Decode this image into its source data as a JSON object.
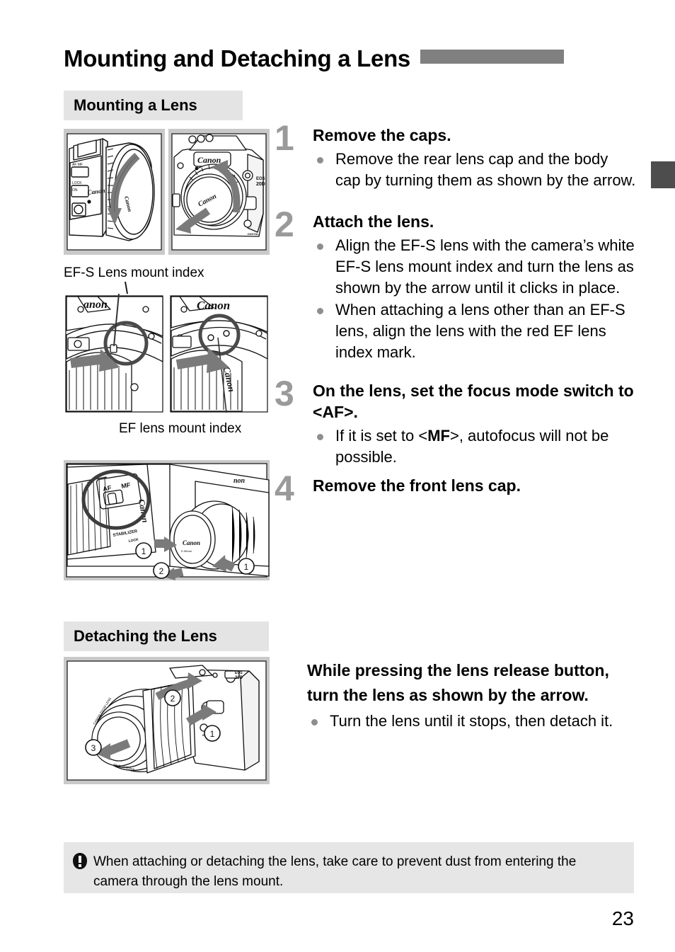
{
  "header": {
    "title": "Mounting and Detaching a Lens",
    "bar_color": "#808080",
    "edge_tab_color": "#4d4d4d"
  },
  "sections": {
    "mounting_label": "Mounting a Lens",
    "detaching_label": "Detaching the Lens",
    "chip_bg": "#e4e4e4"
  },
  "captions": {
    "efs_index": "EF-S Lens mount index",
    "ef_index": "EF lens mount index"
  },
  "figures": {
    "lens_cap": {
      "name": "lens-with-rear-cap",
      "labels": [
        "Canon",
        "AF",
        "MF",
        "LOCK",
        "ON"
      ]
    },
    "body_cap": {
      "name": "camera-body-with-body-cap",
      "labels": [
        "Canon",
        "EOS",
        "20D",
        "DIGITAL"
      ]
    },
    "efs_index": {
      "name": "efs-lens-mount-index-closeup",
      "labels": [
        "Canon"
      ]
    },
    "ef_index": {
      "name": "ef-lens-mount-index-closeup",
      "labels": [
        "Canon"
      ]
    },
    "focus_switch": {
      "name": "focus-mode-switch-and-front-cap",
      "labels": [
        "AF",
        "MF",
        "STABILIZER",
        "Canon",
        "Canon"
      ],
      "markers": [
        "1",
        "2",
        "1"
      ]
    },
    "detach": {
      "name": "detaching-lens-from-body",
      "labels": [
        "EOS",
        "20D",
        "CANON ZOOM LENS",
        "Canon",
        "DIGITAL"
      ],
      "markers": [
        "1",
        "2",
        "3"
      ]
    }
  },
  "steps": [
    {
      "number": "1",
      "title": "Remove the caps.",
      "bullets": [
        "Remove the rear lens cap and the body cap by turning them as shown by the arrow."
      ]
    },
    {
      "number": "2",
      "title": "Attach the lens.",
      "bullets": [
        "Align the EF-S lens with the camera’s white EF-S lens mount index and turn the lens as shown by the arrow until it clicks in place.",
        "When attaching a lens other than an EF-S lens, align the lens with the red EF lens index mark."
      ]
    },
    {
      "number": "3",
      "title_pre": "On the lens, set the focus mode switch to <",
      "title_mark": "AF",
      "title_post": ">.",
      "number_label": "3",
      "bullet_pre": "If it is set to <",
      "bullet_mark": "MF",
      "bullet_post": ">, autofocus will not be possible."
    },
    {
      "number": "4",
      "title": "Remove the front lens cap."
    }
  ],
  "detaching": {
    "title": "While pressing the lens release button, turn the lens as shown by the arrow.",
    "bullets": [
      "Turn the lens until it stops, then detach it."
    ]
  },
  "note": {
    "icon": "caution-icon",
    "text": "When attaching or detaching the lens, take care to prevent dust from entering the camera through the lens mount.",
    "bg": "#e6e6e6"
  },
  "page_number": "23"
}
